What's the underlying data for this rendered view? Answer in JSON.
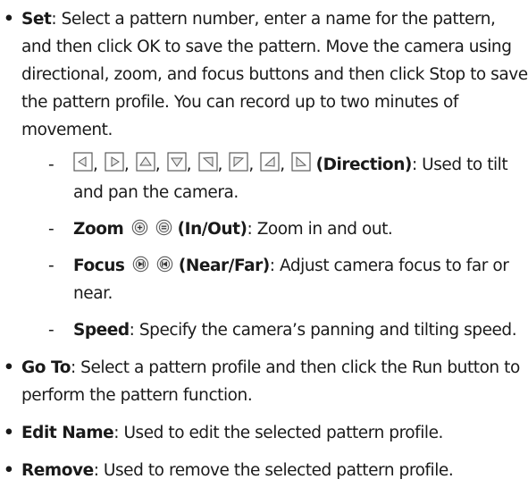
{
  "items": [
    {
      "title": "Set",
      "text": ": Select a pattern number, enter a name for the pattern, and then click OK to save the pattern. Move the camera using directional, zoom, and focus buttons and then click Stop to save the pattern profile. You can record up to two minutes of movement.",
      "subitems": {
        "direction": {
          "title": "(Direction)",
          "text": ": Used to tilt and pan the camera.",
          "icons": [
            "arrow-left-icon",
            "arrow-right-icon",
            "arrow-up-icon",
            "arrow-down-icon",
            "arrow-down-right-icon",
            "arrow-down-left-icon",
            "arrow-up-right-icon",
            "arrow-up-left-icon"
          ]
        },
        "zoom": {
          "title": "Zoom",
          "title2": "(In/Out)",
          "text": ": Zoom in and out.",
          "icons": [
            "zoom-in-icon",
            "zoom-out-icon"
          ]
        },
        "focus": {
          "title": "Focus",
          "title2": "(Near/Far)",
          "text": ": Adjust camera focus to far or near.",
          "icons": [
            "focus-near-icon",
            "focus-far-icon"
          ]
        },
        "speed": {
          "title": "Speed",
          "text": ": Specify the camera’s panning and tilting speed."
        }
      }
    },
    {
      "title": "Go To",
      "text": ": Select a pattern profile and then click the Run button to perform the pattern function."
    },
    {
      "title": "Edit Name",
      "text": ": Used to edit the selected pattern profile."
    },
    {
      "title": "Remove",
      "text": ": Used to remove the selected pattern profile."
    }
  ],
  "glyphs": {
    "bullet": "•",
    "dash": "-",
    "comma": ","
  },
  "colors": {
    "text": "#1a1a1a",
    "icon_border": "#5a5a5a",
    "icon_fill": "#e9e9e9"
  }
}
